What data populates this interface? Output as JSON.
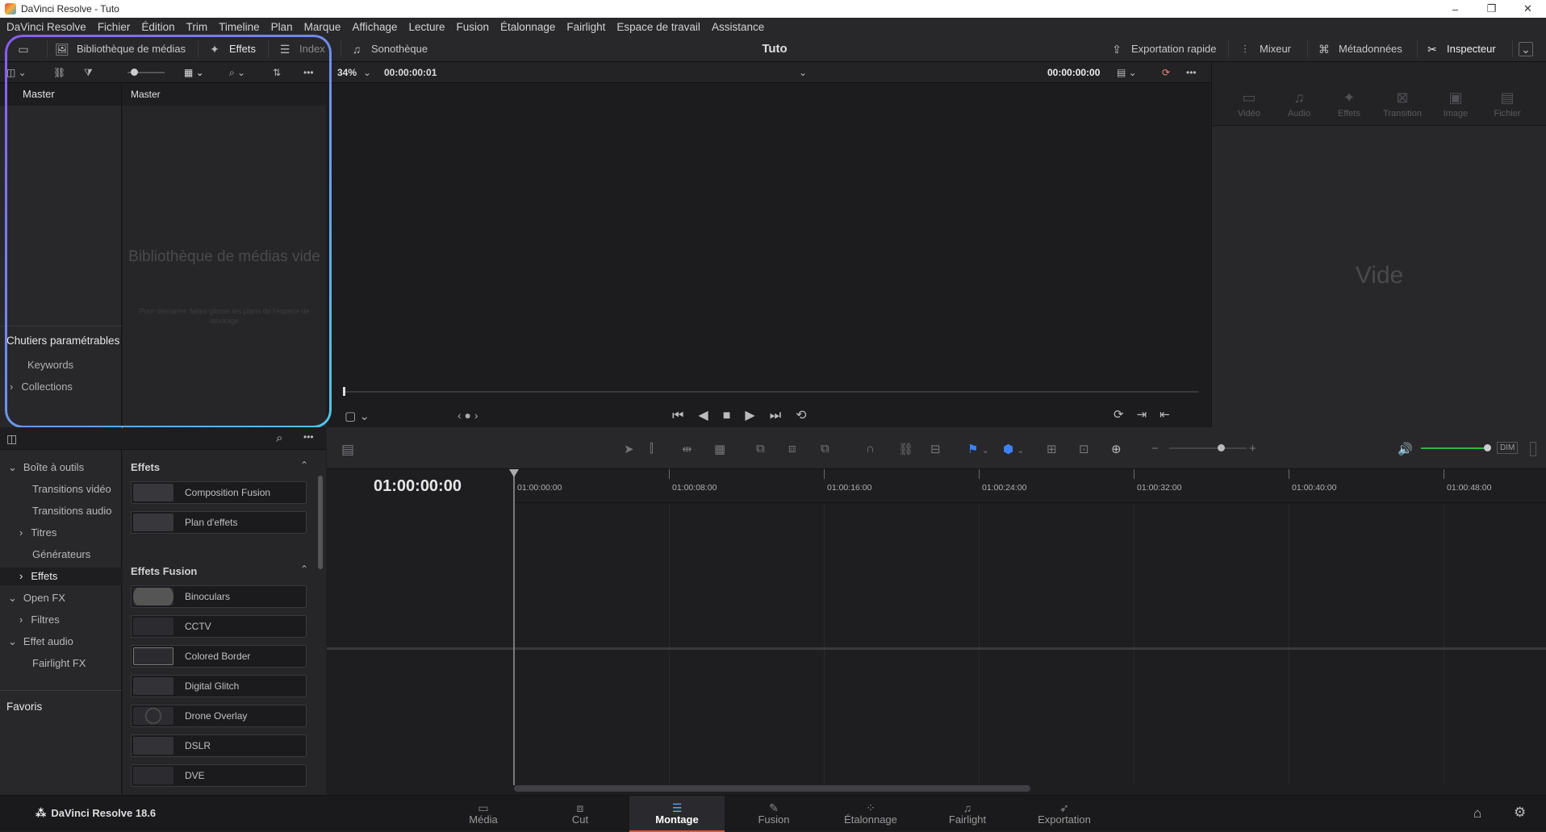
{
  "window": {
    "title": "DaVinci Resolve - Tuto",
    "controls": [
      "–",
      "❐",
      "✕"
    ]
  },
  "menu": [
    "DaVinci Resolve",
    "Fichier",
    "Édition",
    "Trim",
    "Timeline",
    "Plan",
    "Marque",
    "Affichage",
    "Lecture",
    "Fusion",
    "Étalonnage",
    "Fairlight",
    "Espace de travail",
    "Assistance"
  ],
  "toolbar": {
    "media_pool": "Bibliothèque de médias",
    "effects": "Effets",
    "index": "Index",
    "sound_library": "Sonothèque",
    "project_title": "Tuto",
    "quick_export": "Exportation rapide",
    "mixer": "Mixeur",
    "metadata": "Métadonnées",
    "inspector": "Inspecteur"
  },
  "subbar": {
    "zoom": "34%",
    "source_timecode": "00:00:00:01",
    "timeline_timecode": "00:00:00:00"
  },
  "media_pool": {
    "bins_header": "Master",
    "pool_header": "Master",
    "empty_title": "Bibliothèque de médias vide",
    "empty_hint": "Pour démarrer, faites glisser les plans de l'espace de stockage",
    "smart_bins": "Chutiers paramétrables",
    "smart_items": [
      "Keywords",
      "Collections"
    ]
  },
  "inspector": {
    "tabs": [
      "Vidéo",
      "Audio",
      "Effets",
      "Transition",
      "Image",
      "Fichier"
    ],
    "empty": "Vide"
  },
  "effects_tree": {
    "toolbox": "Boîte à outils",
    "items": [
      "Transitions vidéo",
      "Transitions audio",
      "Titres",
      "Générateurs",
      "Effets"
    ],
    "openfx": "Open FX",
    "filters": "Filtres",
    "audio_fx": "Effet audio",
    "fairlight_fx": "Fairlight FX",
    "favorites": "Favoris"
  },
  "effects_list": {
    "section1": "Effets",
    "section1_items": [
      "Composition Fusion",
      "Plan d'effets"
    ],
    "section2": "Effets Fusion",
    "section2_items": [
      "Binoculars",
      "CCTV",
      "Colored Border",
      "Digital Glitch",
      "Drone Overlay",
      "DSLR",
      "DVE"
    ]
  },
  "timeline": {
    "timecode": "01:00:00:00",
    "ruler": [
      "01:00:00:00",
      "01:00:08:00",
      "01:00:16:00",
      "01:00:24:00",
      "01:00:32:00",
      "01:00:40:00",
      "01:00:48:00"
    ],
    "dim": "DIM"
  },
  "bottom": {
    "brand": "DaVinci Resolve 18.6",
    "pages": [
      "Média",
      "Cut",
      "Montage",
      "Fusion",
      "Étalonnage",
      "Fairlight",
      "Exportation"
    ],
    "active_page": "Montage"
  }
}
